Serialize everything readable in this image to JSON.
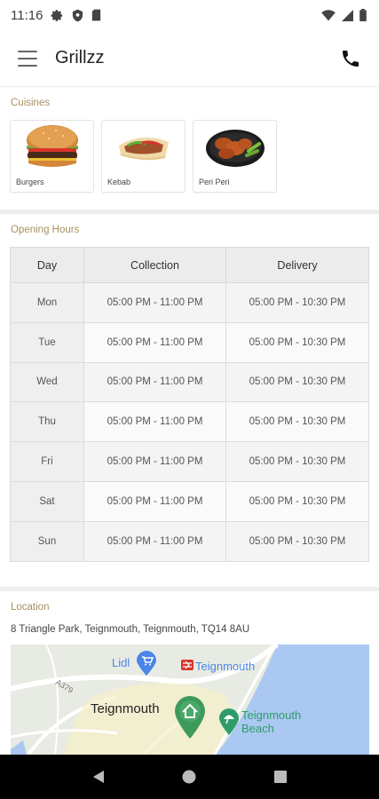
{
  "status_bar": {
    "time": "11:16"
  },
  "app_bar": {
    "title": "Grillzz"
  },
  "cuisines": {
    "title": "Cuisines",
    "items": [
      {
        "label": "Burgers",
        "icon": "burger-image"
      },
      {
        "label": "Kebab",
        "icon": "kebab-image"
      },
      {
        "label": "Peri Peri",
        "icon": "peri-peri-image"
      }
    ]
  },
  "opening_hours": {
    "title": "Opening Hours",
    "headers": [
      "Day",
      "Collection",
      "Delivery"
    ],
    "rows": [
      {
        "day": "Mon",
        "collection": "05:00 PM - 11:00 PM",
        "delivery": "05:00 PM - 10:30 PM"
      },
      {
        "day": "Tue",
        "collection": "05:00 PM - 11:00 PM",
        "delivery": "05:00 PM - 10:30 PM"
      },
      {
        "day": "Wed",
        "collection": "05:00 PM - 11:00 PM",
        "delivery": "05:00 PM - 10:30 PM"
      },
      {
        "day": "Thu",
        "collection": "05:00 PM - 11:00 PM",
        "delivery": "05:00 PM - 10:30 PM"
      },
      {
        "day": "Fri",
        "collection": "05:00 PM - 11:00 PM",
        "delivery": "05:00 PM - 10:30 PM"
      },
      {
        "day": "Sat",
        "collection": "05:00 PM - 11:00 PM",
        "delivery": "05:00 PM - 10:30 PM"
      },
      {
        "day": "Sun",
        "collection": "05:00 PM - 11:00 PM",
        "delivery": "05:00 PM - 10:30 PM"
      }
    ]
  },
  "location": {
    "title": "Location",
    "address": "8 Triangle Park, Teignmouth, Teignmouth, TQ14 8AU",
    "map": {
      "labels": {
        "lidl": "Lidl",
        "station": "Teignmouth",
        "road": "A379",
        "town": "Teignmouth",
        "beach_line1": "Teignmouth",
        "beach_line2": "Beach"
      }
    }
  },
  "colors": {
    "accent_section_title": "#a99060",
    "map_water": "#aac8f2",
    "map_pin": "#3d9a5b",
    "lidl_pin": "#4a86e8"
  }
}
